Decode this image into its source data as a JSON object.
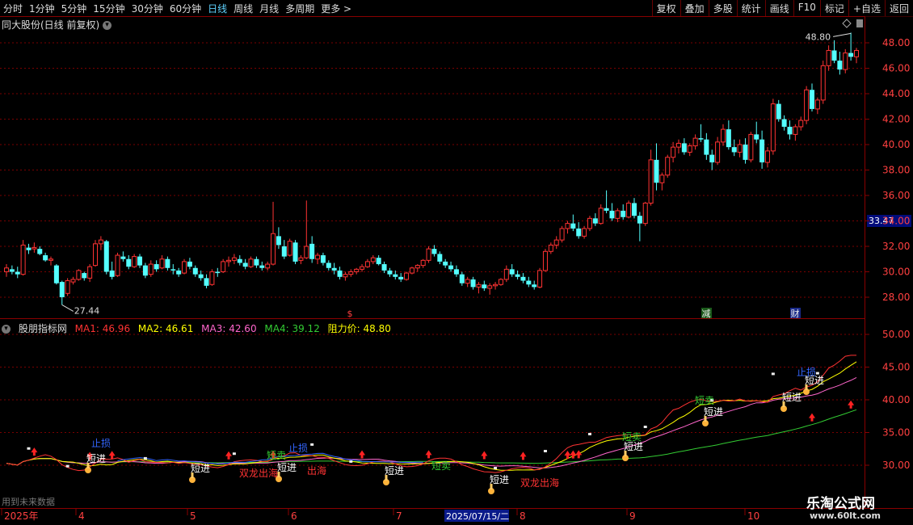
{
  "toolbar": {
    "periods": [
      "分时",
      "1分钟",
      "5分钟",
      "15分钟",
      "30分钟",
      "60分钟",
      "日线",
      "周线",
      "月线",
      "多周期",
      "更多 >"
    ],
    "active_period": "日线",
    "right_buttons": [
      "复权",
      "叠加",
      "多股",
      "统计",
      "画线",
      "F10",
      "标记",
      "+自选",
      "返回"
    ]
  },
  "main_chart": {
    "title": "同大股份(日线 前复权)",
    "y_ticks": [
      "48.00",
      "46.00",
      "44.00",
      "42.00",
      "40.00",
      "38.00",
      "36.00",
      "34.00",
      "32.00",
      "30.00",
      "28.00"
    ],
    "high_label": "48.80",
    "low_label": "27.44",
    "current_price": "33.47",
    "markers": [
      "$",
      "减",
      "财"
    ]
  },
  "indicator": {
    "name": "股朋指标网",
    "ma1": "MA1: 46.96",
    "ma2": "MA2: 46.61",
    "ma3": "MA3: 42.60",
    "ma4": "MA4: 39.12",
    "resist": "阻力价: 48.80",
    "y_ticks": [
      "50.00",
      "45.00",
      "40.00",
      "35.00",
      "30.00"
    ],
    "signals": {
      "buy": "短进",
      "sell": "短卖",
      "stop": "止损",
      "dragon": "双龙出海"
    },
    "footer": "用到未来数据"
  },
  "x_axis": {
    "labels": [
      "2025年",
      "4",
      "5",
      "6",
      "7",
      "8",
      "9",
      "10"
    ],
    "cursor_date": "2025/07/15/二"
  },
  "watermark": {
    "line1": "乐淘公式网",
    "line2": "www.60lt.com"
  },
  "colors": {
    "up": "#ff3333",
    "down": "#54ffff",
    "ma1": "#ff3333",
    "ma2": "#ffff00",
    "ma3": "#ff66cc",
    "ma4": "#33cc33"
  },
  "chart_data": {
    "type": "candlestick",
    "title": "同大股份(日线 前复权)",
    "ylim": [
      27,
      49.5
    ],
    "series": [
      {
        "values": [
          [
            30.0,
            30.6,
            29.6,
            30.3
          ],
          [
            30.2,
            30.5,
            29.8,
            30.0
          ],
          [
            30.0,
            30.4,
            29.5,
            29.8
          ],
          [
            29.8,
            32.5,
            29.7,
            32.1
          ],
          [
            31.9,
            32.2,
            31.4,
            31.7
          ],
          [
            31.8,
            32.3,
            31.5,
            31.9
          ],
          [
            31.8,
            32.0,
            31.3,
            31.4
          ],
          [
            31.3,
            31.5,
            30.8,
            30.9
          ],
          [
            30.9,
            31.2,
            30.5,
            31.0
          ],
          [
            30.5,
            30.6,
            29.0,
            29.1
          ],
          [
            29.2,
            29.3,
            27.4,
            28.0
          ],
          [
            28.3,
            29.5,
            28.1,
            29.3
          ],
          [
            29.2,
            29.6,
            29.0,
            29.4
          ],
          [
            29.4,
            30.2,
            29.3,
            30.1
          ],
          [
            29.9,
            30.0,
            29.3,
            29.5
          ],
          [
            29.5,
            30.6,
            29.2,
            30.4
          ],
          [
            30.5,
            32.5,
            30.4,
            32.2
          ],
          [
            32.2,
            32.8,
            31.7,
            32.5
          ],
          [
            32.4,
            32.5,
            29.8,
            30.0
          ],
          [
            30.1,
            30.8,
            29.4,
            29.6
          ],
          [
            29.7,
            31.5,
            29.6,
            31.3
          ],
          [
            31.2,
            31.6,
            30.8,
            31.0
          ],
          [
            31.0,
            31.3,
            30.2,
            30.4
          ],
          [
            30.4,
            31.4,
            30.3,
            31.2
          ],
          [
            31.2,
            31.4,
            30.3,
            30.5
          ],
          [
            30.5,
            30.7,
            29.5,
            29.7
          ],
          [
            29.8,
            30.9,
            29.6,
            30.6
          ],
          [
            30.6,
            30.9,
            30.0,
            30.2
          ],
          [
            30.3,
            31.3,
            30.2,
            31.0
          ],
          [
            31.0,
            31.2,
            30.1,
            30.3
          ],
          [
            30.2,
            30.6,
            29.8,
            30.1
          ],
          [
            30.1,
            30.3,
            29.6,
            29.8
          ],
          [
            29.9,
            31.0,
            29.8,
            30.8
          ],
          [
            30.8,
            31.1,
            30.2,
            30.4
          ],
          [
            30.3,
            30.5,
            29.6,
            29.8
          ],
          [
            29.8,
            30.1,
            29.3,
            29.5
          ],
          [
            29.5,
            29.8,
            28.7,
            28.9
          ],
          [
            29.0,
            30.2,
            28.9,
            30.0
          ],
          [
            30.0,
            30.3,
            29.6,
            29.9
          ],
          [
            30.0,
            31.0,
            29.9,
            30.8
          ],
          [
            30.8,
            31.2,
            30.4,
            30.9
          ],
          [
            30.9,
            31.4,
            30.6,
            31.1
          ],
          [
            31.0,
            31.3,
            30.5,
            30.7
          ],
          [
            30.7,
            31.0,
            30.2,
            30.4
          ],
          [
            30.4,
            31.2,
            30.3,
            31.0
          ],
          [
            31.0,
            31.2,
            30.3,
            30.5
          ],
          [
            30.5,
            30.8,
            30.1,
            30.3
          ],
          [
            30.3,
            30.8,
            30.1,
            30.6
          ],
          [
            30.6,
            35.5,
            30.5,
            33.0
          ],
          [
            32.8,
            33.5,
            31.8,
            32.1
          ],
          [
            32.0,
            32.5,
            31.0,
            31.2
          ],
          [
            31.3,
            32.6,
            31.2,
            32.4
          ],
          [
            32.3,
            32.5,
            30.6,
            30.8
          ],
          [
            30.9,
            31.3,
            30.6,
            31.1
          ],
          [
            31.1,
            35.6,
            31.0,
            32.0
          ],
          [
            32.2,
            32.8,
            30.7,
            31.0
          ],
          [
            31.0,
            31.5,
            30.6,
            31.3
          ],
          [
            31.3,
            31.5,
            30.5,
            30.7
          ],
          [
            30.7,
            30.9,
            30.1,
            30.3
          ],
          [
            30.3,
            30.7,
            29.8,
            30.1
          ],
          [
            30.1,
            30.4,
            29.4,
            29.6
          ],
          [
            29.6,
            30.0,
            29.3,
            29.8
          ],
          [
            29.8,
            30.2,
            29.6,
            30.0
          ],
          [
            30.0,
            30.3,
            29.8,
            30.2
          ],
          [
            30.2,
            30.6,
            30.0,
            30.4
          ],
          [
            30.4,
            31.0,
            30.3,
            30.8
          ],
          [
            30.8,
            31.3,
            30.6,
            31.1
          ],
          [
            31.1,
            31.3,
            30.5,
            30.6
          ],
          [
            30.6,
            30.8,
            29.9,
            30.1
          ],
          [
            30.1,
            30.3,
            29.6,
            29.8
          ],
          [
            29.8,
            30.1,
            29.4,
            29.6
          ],
          [
            29.6,
            29.9,
            29.2,
            29.4
          ],
          [
            29.4,
            30.0,
            29.3,
            29.9
          ],
          [
            29.9,
            30.4,
            29.8,
            30.3
          ],
          [
            30.3,
            30.6,
            30.0,
            30.5
          ],
          [
            30.5,
            31.0,
            30.3,
            30.9
          ],
          [
            30.9,
            32.0,
            30.7,
            31.8
          ],
          [
            31.8,
            32.1,
            31.2,
            31.4
          ],
          [
            31.4,
            31.6,
            30.6,
            30.8
          ],
          [
            30.8,
            31.0,
            30.3,
            30.5
          ],
          [
            30.5,
            30.8,
            30.0,
            30.2
          ],
          [
            30.2,
            30.5,
            29.6,
            29.8
          ],
          [
            29.8,
            30.0,
            28.9,
            29.1
          ],
          [
            29.1,
            29.6,
            28.8,
            29.4
          ],
          [
            29.4,
            29.6,
            28.6,
            28.8
          ],
          [
            28.8,
            29.2,
            28.3,
            29.0
          ],
          [
            29.0,
            29.3,
            28.5,
            28.7
          ],
          [
            28.7,
            29.1,
            28.2,
            28.9
          ],
          [
            28.9,
            29.2,
            28.6,
            29.0
          ],
          [
            29.0,
            29.5,
            28.9,
            29.4
          ],
          [
            29.4,
            30.5,
            29.2,
            30.2
          ],
          [
            30.2,
            30.6,
            29.6,
            29.8
          ],
          [
            29.8,
            30.1,
            29.4,
            29.6
          ],
          [
            29.6,
            29.9,
            29.1,
            29.3
          ],
          [
            29.3,
            29.6,
            28.8,
            29.0
          ],
          [
            29.0,
            29.3,
            28.6,
            28.8
          ],
          [
            28.8,
            30.3,
            28.7,
            30.1
          ],
          [
            30.1,
            31.8,
            30.0,
            31.6
          ],
          [
            31.6,
            32.3,
            31.4,
            32.1
          ],
          [
            32.1,
            32.8,
            31.8,
            32.5
          ],
          [
            32.5,
            33.6,
            32.3,
            33.4
          ],
          [
            33.4,
            34.0,
            33.0,
            33.8
          ],
          [
            33.8,
            34.5,
            33.2,
            33.4
          ],
          [
            33.4,
            33.9,
            32.6,
            32.8
          ],
          [
            32.8,
            33.6,
            32.6,
            33.4
          ],
          [
            33.4,
            34.4,
            33.2,
            34.2
          ],
          [
            34.2,
            34.6,
            33.6,
            33.8
          ],
          [
            33.8,
            35.3,
            33.7,
            35.0
          ],
          [
            35.0,
            36.4,
            34.6,
            34.8
          ],
          [
            34.8,
            35.4,
            34.0,
            34.2
          ],
          [
            34.2,
            35.0,
            33.9,
            34.8
          ],
          [
            34.8,
            35.3,
            34.1,
            34.3
          ],
          [
            34.3,
            35.6,
            34.2,
            35.4
          ],
          [
            35.4,
            35.8,
            34.2,
            34.4
          ],
          [
            34.4,
            34.7,
            32.4,
            33.8
          ],
          [
            33.8,
            35.5,
            33.6,
            35.4
          ],
          [
            35.4,
            39.6,
            35.2,
            38.8
          ],
          [
            38.8,
            40.1,
            36.4,
            37.0
          ],
          [
            37.0,
            37.8,
            36.4,
            37.6
          ],
          [
            37.6,
            39.2,
            37.4,
            39.0
          ],
          [
            39.0,
            40.2,
            38.6,
            39.8
          ],
          [
            39.8,
            40.4,
            39.3,
            40.1
          ],
          [
            40.1,
            40.5,
            39.2,
            39.4
          ],
          [
            39.4,
            40.1,
            39.1,
            39.9
          ],
          [
            39.9,
            40.8,
            39.6,
            40.5
          ],
          [
            40.5,
            41.6,
            40.2,
            40.4
          ],
          [
            40.4,
            40.9,
            38.8,
            39.2
          ],
          [
            39.2,
            39.6,
            38.0,
            38.6
          ],
          [
            38.6,
            40.6,
            38.4,
            40.2
          ],
          [
            40.2,
            41.6,
            39.9,
            41.2
          ],
          [
            41.2,
            41.9,
            39.6,
            39.8
          ],
          [
            39.8,
            40.4,
            39.1,
            39.4
          ],
          [
            39.4,
            40.4,
            39.0,
            40.0
          ],
          [
            40.0,
            40.5,
            38.5,
            38.8
          ],
          [
            38.8,
            41.0,
            38.6,
            40.8
          ],
          [
            40.8,
            41.8,
            40.1,
            40.4
          ],
          [
            40.4,
            41.1,
            38.1,
            38.6
          ],
          [
            38.6,
            39.8,
            38.2,
            39.5
          ],
          [
            39.5,
            43.6,
            39.2,
            43.2
          ],
          [
            43.2,
            43.5,
            41.8,
            42.0
          ],
          [
            42.0,
            42.3,
            41.1,
            41.4
          ],
          [
            41.4,
            41.9,
            40.4,
            40.8
          ],
          [
            40.8,
            41.6,
            40.3,
            41.4
          ],
          [
            41.4,
            42.2,
            41.1,
            41.9
          ],
          [
            41.9,
            44.6,
            41.6,
            44.3
          ],
          [
            44.3,
            44.8,
            42.6,
            42.8
          ],
          [
            42.8,
            43.7,
            42.4,
            43.5
          ],
          [
            43.5,
            46.6,
            43.2,
            46.2
          ],
          [
            46.2,
            47.8,
            45.8,
            47.4
          ],
          [
            47.4,
            48.2,
            46.4,
            46.6
          ],
          [
            46.6,
            47.3,
            45.5,
            45.9
          ],
          [
            45.9,
            47.5,
            45.6,
            47.2
          ],
          [
            47.2,
            48.8,
            46.6,
            46.9
          ],
          [
            46.9,
            47.6,
            46.4,
            47.4
          ]
        ]
      }
    ]
  }
}
